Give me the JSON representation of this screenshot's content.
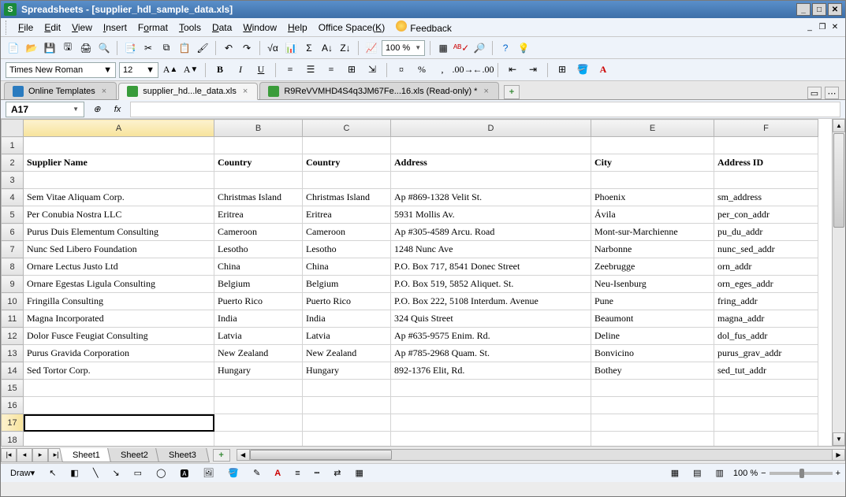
{
  "titlebar": {
    "app": "Spreadsheets",
    "doc": "[supplier_hdl_sample_data.xls]"
  },
  "menus": {
    "file": "File",
    "edit": "Edit",
    "view": "View",
    "insert": "Insert",
    "format": "Format",
    "tools": "Tools",
    "data": "Data",
    "window": "Window",
    "help": "Help",
    "office": "Office Space(K)",
    "feedback": "Feedback"
  },
  "toolbar": {
    "zoom": "100 %"
  },
  "format": {
    "font": "Times New Roman",
    "size": "12"
  },
  "docTabs": {
    "t1": "Online Templates",
    "t2": "supplier_hd...le_data.xls",
    "t3": "R9ReVVMHD4S4q3JM67Fe...16.xls (Read-only) *"
  },
  "namebox": "A17",
  "cols": {
    "A": "A",
    "B": "B",
    "C": "C",
    "D": "D",
    "E": "E",
    "F": "F"
  },
  "rows": {
    "r1": {
      "n": "1",
      "A": "",
      "B": "",
      "C": "",
      "D": "",
      "E": "",
      "F": ""
    },
    "r2": {
      "n": "2",
      "A": "Supplier Name",
      "B": "Country",
      "C": "Country",
      "D": "Address",
      "E": "City",
      "F": "Address ID"
    },
    "r3": {
      "n": "3",
      "A": "",
      "B": "",
      "C": "",
      "D": "",
      "E": "",
      "F": ""
    },
    "r4": {
      "n": "4",
      "A": "Sem Vitae Aliquam Corp.",
      "B": "Christmas Island",
      "C": "Christmas Island",
      "D": "Ap #869-1328 Velit St.",
      "E": "Phoenix",
      "F": "sm_address"
    },
    "r5": {
      "n": "5",
      "A": "Per Conubia Nostra LLC",
      "B": "Eritrea",
      "C": "Eritrea",
      "D": "5931 Mollis Av.",
      "E": "Ávila",
      "F": "per_con_addr"
    },
    "r6": {
      "n": "6",
      "A": "Purus Duis Elementum Consulting",
      "B": "Cameroon",
      "C": "Cameroon",
      "D": "Ap #305-4589 Arcu. Road",
      "E": "Mont-sur-Marchienne",
      "F": "pu_du_addr"
    },
    "r7": {
      "n": "7",
      "A": "Nunc Sed Libero Foundation",
      "B": "Lesotho",
      "C": "Lesotho",
      "D": "1248 Nunc Ave",
      "E": "Narbonne",
      "F": "nunc_sed_addr"
    },
    "r8": {
      "n": "8",
      "A": "Ornare Lectus Justo Ltd",
      "B": "China",
      "C": "China",
      "D": "P.O. Box 717, 8541 Donec Street",
      "E": "Zeebrugge",
      "F": "orn_addr"
    },
    "r9": {
      "n": "9",
      "A": "Ornare Egestas Ligula Consulting",
      "B": "Belgium",
      "C": "Belgium",
      "D": "P.O. Box 519, 5852 Aliquet. St.",
      "E": "Neu-Isenburg",
      "F": "orn_eges_addr"
    },
    "r10": {
      "n": "10",
      "A": "Fringilla Consulting",
      "B": "Puerto Rico",
      "C": "Puerto Rico",
      "D": "P.O. Box 222, 5108 Interdum. Avenue",
      "E": "Pune",
      "F": "fring_addr"
    },
    "r11": {
      "n": "11",
      "A": "Magna Incorporated",
      "B": "India",
      "C": "India",
      "D": "324 Quis Street",
      "E": "Beaumont",
      "F": "magna_addr"
    },
    "r12": {
      "n": "12",
      "A": "Dolor Fusce Feugiat Consulting",
      "B": "Latvia",
      "C": "Latvia",
      "D": "Ap #635-9575 Enim. Rd.",
      "E": "Deline",
      "F": "dol_fus_addr"
    },
    "r13": {
      "n": "13",
      "A": "Purus Gravida Corporation",
      "B": "New Zealand",
      "C": "New Zealand",
      "D": "Ap #785-2968 Quam. St.",
      "E": "Bonvicino",
      "F": "purus_grav_addr"
    },
    "r14": {
      "n": "14",
      "A": "Sed Tortor Corp.",
      "B": "Hungary",
      "C": "Hungary",
      "D": "892-1376 Elit, Rd.",
      "E": "Bothey",
      "F": "sed_tut_addr"
    },
    "r15": {
      "n": "15",
      "A": "",
      "B": "",
      "C": "",
      "D": "",
      "E": "",
      "F": ""
    },
    "r16": {
      "n": "16",
      "A": "",
      "B": "",
      "C": "",
      "D": "",
      "E": "",
      "F": ""
    },
    "r17": {
      "n": "17",
      "A": "",
      "B": "",
      "C": "",
      "D": "",
      "E": "",
      "F": ""
    },
    "r18": {
      "n": "18",
      "A": "",
      "B": "",
      "C": "",
      "D": "",
      "E": "",
      "F": ""
    }
  },
  "sheets": {
    "s1": "Sheet1",
    "s2": "Sheet2",
    "s3": "Sheet3"
  },
  "status": {
    "draw": "Draw",
    "zoom": "100 %"
  }
}
